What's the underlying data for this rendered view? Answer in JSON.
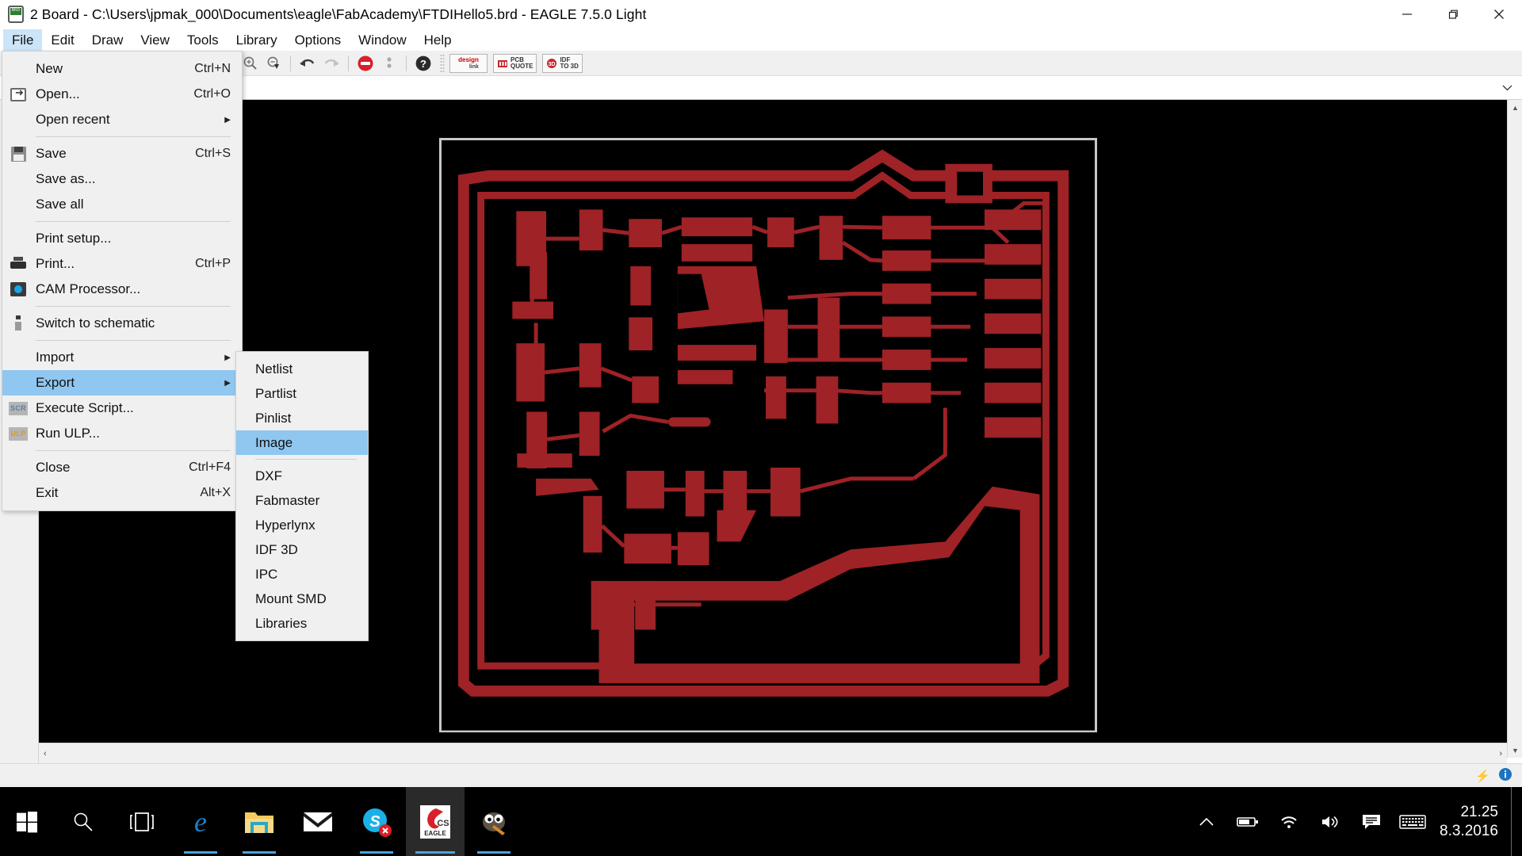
{
  "window": {
    "title": "2 Board - C:\\Users\\jpmak_000\\Documents\\eagle\\FabAcademy\\FTDIHello5.brd - EAGLE 7.5.0 Light",
    "icon": "board-file-icon",
    "minimize_label": "—",
    "maximize_label": "❐",
    "close_label": "✕"
  },
  "menubar": {
    "items": [
      {
        "label": "File",
        "active": true
      },
      {
        "label": "Edit",
        "active": false
      },
      {
        "label": "Draw",
        "active": false
      },
      {
        "label": "View",
        "active": false
      },
      {
        "label": "Tools",
        "active": false
      },
      {
        "label": "Library",
        "active": false
      },
      {
        "label": "Options",
        "active": false
      },
      {
        "label": "Window",
        "active": false
      },
      {
        "label": "Help",
        "active": false
      }
    ]
  },
  "toolbar": {
    "buttons": [
      {
        "name": "zoom-in-icon"
      },
      {
        "name": "zoom-out-icon"
      },
      {
        "name": "undo-icon"
      },
      {
        "name": "redo-icon"
      },
      {
        "name": "stop-icon"
      },
      {
        "name": "more-options-icon"
      },
      {
        "name": "help-icon"
      }
    ],
    "plugins": [
      {
        "name": "design-link-button",
        "line1": "design",
        "line2": "link"
      },
      {
        "name": "pcb-quote-button",
        "line1": "PCB",
        "line2": "QUOTE"
      },
      {
        "name": "idf-to-3d-button",
        "line1": "IDF",
        "line2": "TO 3D"
      }
    ]
  },
  "file_menu": {
    "name": "file-menu",
    "items": [
      {
        "label": "New",
        "accel": "Ctrl+N",
        "icon": "",
        "selected": false,
        "submenu": false
      },
      {
        "label": "Open...",
        "accel": "Ctrl+O",
        "icon": "open-icon",
        "selected": false,
        "submenu": false
      },
      {
        "label": "Open recent",
        "accel": "",
        "icon": "",
        "selected": false,
        "submenu": true
      },
      {
        "separator": true
      },
      {
        "label": "Save",
        "accel": "Ctrl+S",
        "icon": "save-icon",
        "selected": false,
        "submenu": false
      },
      {
        "label": "Save as...",
        "accel": "",
        "icon": "",
        "selected": false,
        "submenu": false
      },
      {
        "label": "Save all",
        "accel": "",
        "icon": "",
        "selected": false,
        "submenu": false
      },
      {
        "separator": true
      },
      {
        "label": "Print setup...",
        "accel": "",
        "icon": "",
        "selected": false,
        "submenu": false
      },
      {
        "label": "Print...",
        "accel": "Ctrl+P",
        "icon": "print-icon",
        "selected": false,
        "submenu": false
      },
      {
        "label": "CAM Processor...",
        "accel": "",
        "icon": "cam-icon",
        "selected": false,
        "submenu": false
      },
      {
        "separator": true
      },
      {
        "label": "Switch to schematic",
        "accel": "",
        "icon": "schematic-icon",
        "selected": false,
        "submenu": false
      },
      {
        "separator": true
      },
      {
        "label": "Import",
        "accel": "",
        "icon": "",
        "selected": false,
        "submenu": true
      },
      {
        "label": "Export",
        "accel": "",
        "icon": "",
        "selected": true,
        "submenu": true
      },
      {
        "label": "Execute Script...",
        "accel": "",
        "icon": "scr-icon",
        "selected": false,
        "submenu": false
      },
      {
        "label": "Run ULP...",
        "accel": "",
        "icon": "ulp-icon",
        "selected": false,
        "submenu": false
      },
      {
        "separator": true
      },
      {
        "label": "Close",
        "accel": "Ctrl+F4",
        "icon": "",
        "selected": false,
        "submenu": false
      },
      {
        "label": "Exit",
        "accel": "Alt+X",
        "icon": "",
        "selected": false,
        "submenu": false
      }
    ]
  },
  "export_menu": {
    "name": "export-submenu",
    "items": [
      {
        "label": "Netlist",
        "selected": false
      },
      {
        "label": "Partlist",
        "selected": false
      },
      {
        "label": "Pinlist",
        "selected": false
      },
      {
        "label": "Image",
        "selected": true
      },
      {
        "separator": true
      },
      {
        "label": "DXF",
        "selected": false
      },
      {
        "label": "Fabmaster",
        "selected": false
      },
      {
        "label": "Hyperlynx",
        "selected": false
      },
      {
        "label": "IDF 3D",
        "selected": false
      },
      {
        "label": "IPC",
        "selected": false
      },
      {
        "label": "Mount SMD",
        "selected": false
      },
      {
        "label": "Libraries",
        "selected": false
      }
    ]
  },
  "canvas": {
    "name": "pcb-board-canvas",
    "background": "#000000",
    "copper_color": "#9e2226",
    "outline_color": "#c8c8c8",
    "description": "PCB board layout of FTDIHello5 - top copper layer"
  },
  "scrollbars": {
    "left_arrow": "‹",
    "right_arrow": "›",
    "up_arrow": "▲",
    "down_arrow": "▼"
  },
  "statusbar": {
    "lightning_icon": "⚡",
    "info_icon": "i"
  },
  "taskbar": {
    "start_label": "start-button",
    "items": [
      {
        "name": "start-button",
        "icon": "windows-logo-icon",
        "state": "idle"
      },
      {
        "name": "search-button",
        "icon": "search-icon",
        "state": "idle"
      },
      {
        "name": "task-view-button",
        "icon": "task-view-icon",
        "state": "idle"
      },
      {
        "name": "edge-button",
        "icon": "edge-icon",
        "state": "running"
      },
      {
        "name": "file-explorer-button",
        "icon": "folder-icon",
        "state": "running"
      },
      {
        "name": "mail-button",
        "icon": "mail-icon",
        "state": "idle"
      },
      {
        "name": "skype-button",
        "icon": "skype-icon",
        "state": "running"
      },
      {
        "name": "eagle-button",
        "icon": "eagle-icon",
        "state": "active"
      },
      {
        "name": "gimp-button",
        "icon": "gimp-icon",
        "state": "running"
      }
    ],
    "tray": [
      {
        "name": "show-hidden-icons",
        "icon": "chevron-up-icon"
      },
      {
        "name": "battery-icon",
        "icon": "battery-icon"
      },
      {
        "name": "wifi-icon",
        "icon": "wifi-icon"
      },
      {
        "name": "volume-icon",
        "icon": "speaker-icon"
      },
      {
        "name": "action-center-icon",
        "icon": "message-icon"
      },
      {
        "name": "keyboard-icon",
        "icon": "keyboard-icon"
      }
    ],
    "clock": {
      "time": "21.25",
      "date": "8.3.2016"
    }
  }
}
